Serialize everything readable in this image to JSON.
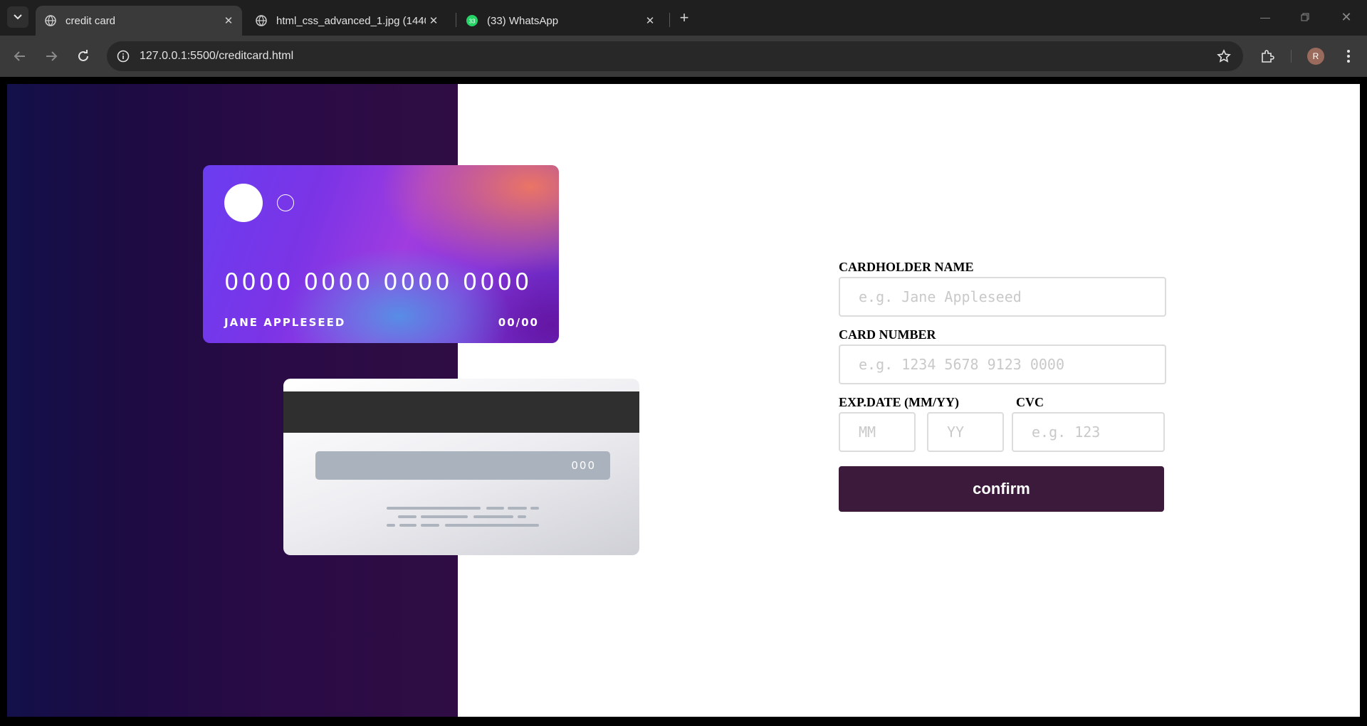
{
  "browser": {
    "tabs": [
      {
        "title": "credit card",
        "active": true
      },
      {
        "title": "html_css_advanced_1.jpg (1440",
        "active": false
      },
      {
        "title": "(33) WhatsApp",
        "active": false,
        "badge": "33"
      }
    ],
    "url": "127.0.0.1:5500/creditcard.html",
    "profile_initial": "R"
  },
  "card_front": {
    "number": "0000 0000 0000 0000",
    "name": "JANE APPLESEED",
    "expiry": "00/00"
  },
  "card_back": {
    "cvc": "000"
  },
  "form": {
    "name_label": "CARDHOLDER NAME",
    "name_placeholder": "e.g. Jane Appleseed",
    "number_label": "CARD NUMBER",
    "number_placeholder": "e.g. 1234 5678 9123 0000",
    "exp_label": "EXP.DATE (MM/YY)",
    "mm_placeholder": "MM",
    "yy_placeholder": "YY",
    "cvc_label": "CVC",
    "cvc_placeholder": "e.g. 123",
    "confirm_label": "confirm"
  },
  "colors": {
    "panel_dark": "#2a0b45",
    "button": "#3b1a3b",
    "chrome_dark": "#1f1f1f",
    "chrome_toolbar": "#3a3a3a"
  }
}
